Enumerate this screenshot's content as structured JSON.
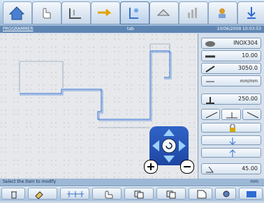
{
  "status": {
    "mode": "PROGRAMMER",
    "center": "tab",
    "datetime": "10/06/2009 10:03:53"
  },
  "bottom": {
    "message": "Select the item to modify",
    "unit": "mm"
  },
  "panel": {
    "material": "INOX304",
    "thickness": "10.00",
    "width": "3050.0",
    "units": "mm/mm",
    "length": "250.00",
    "angle": "45.00"
  },
  "colors": {
    "accent": "#1f57c8",
    "status_bar": "#5f86b3"
  },
  "icons": {
    "top_tabs": [
      "home-icon",
      "hand-icon",
      "bend-icon",
      "arrow-icon",
      "tab-icon",
      "tool-icon",
      "graph-icon",
      "robot-icon",
      "download-icon"
    ],
    "bottom_tools": [
      "trash-icon",
      "edit-icon",
      "grid-icon",
      "hand-icon",
      "copy-icon",
      "copy-icon",
      "document-icon",
      "settings-icon",
      "window-icon"
    ]
  }
}
